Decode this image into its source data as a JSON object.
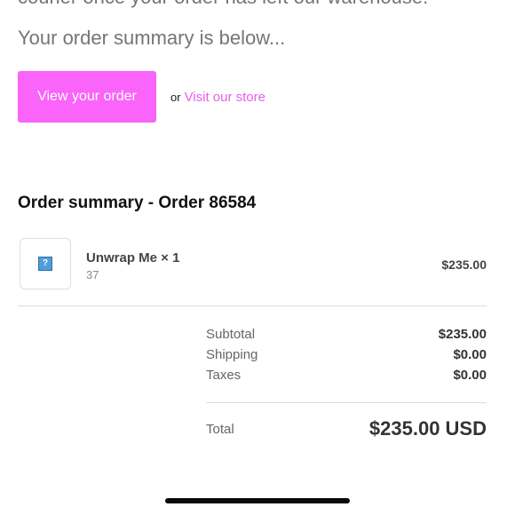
{
  "intro": {
    "partial_text": "courier once your order has left our warehouse.",
    "summary_text": "Your order summary is below..."
  },
  "actions": {
    "view_order_label": "View your order",
    "or_text": "or",
    "store_link_label": "Visit our store"
  },
  "order": {
    "heading": "Order summary - Order 86584",
    "items": [
      {
        "name": "Unwrap Me × 1",
        "subtext": "37",
        "price": "$235.00",
        "thumbnail_icon": "broken-image-icon"
      }
    ]
  },
  "totals": {
    "subtotal_label": "Subtotal",
    "subtotal_value": "$235.00",
    "shipping_label": "Shipping",
    "shipping_value": "$0.00",
    "taxes_label": "Taxes",
    "taxes_value": "$0.00",
    "total_label": "Total",
    "total_value": "$235.00 USD"
  },
  "colors": {
    "accent": "#fa64fa",
    "link": "#e95ee9",
    "muted_text": "#757575"
  }
}
